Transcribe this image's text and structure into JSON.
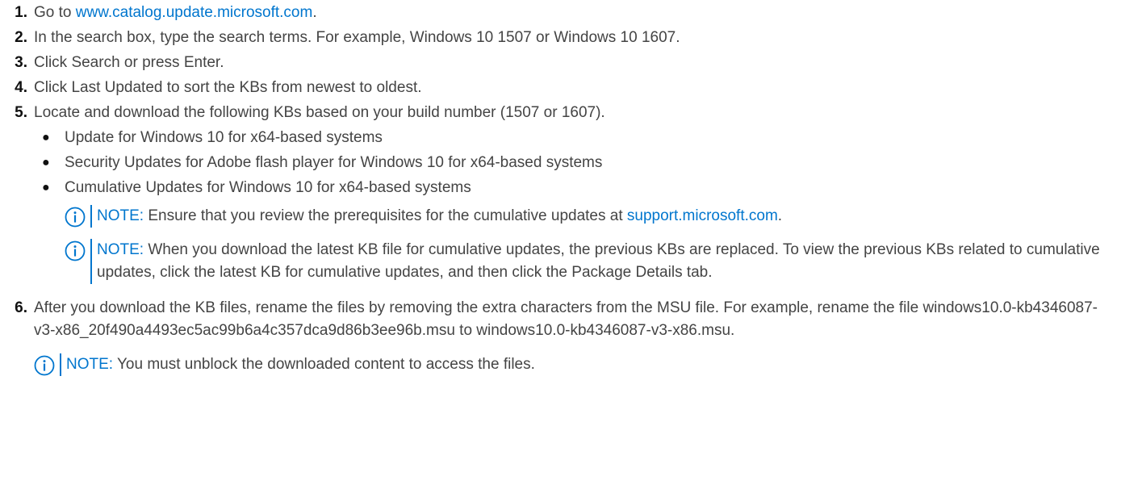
{
  "steps": [
    {
      "num": "1.",
      "prefix": "Go to ",
      "link": "www.catalog.update.microsoft.com",
      "suffix": "."
    },
    {
      "num": "2.",
      "text": "In the search box, type the search terms. For example, Windows 10 1507 or Windows 10 1607."
    },
    {
      "num": "3.",
      "text": "Click Search or press Enter."
    },
    {
      "num": "4.",
      "text": "Click Last Updated to sort the KBs from newest to oldest."
    },
    {
      "num": "5.",
      "text": "Locate and download the following KBs based on your build number (1507 or 1607)."
    },
    {
      "num": "6.",
      "text": "After you download the KB files, rename the files by removing the extra characters from the MSU file. For example, rename the file windows10.0-kb4346087-v3-x86_20f490a4493ec5ac99b6a4c357dca9d86b3ee96b.msu to windows10.0-kb4346087-v3-x86.msu."
    }
  ],
  "bullet_symbol": "●",
  "bullets": [
    "Update for Windows 10 for x64-based systems",
    "Security Updates for Adobe flash player for Windows 10 for x64-based systems",
    "Cumulative Updates for Windows 10 for x64-based systems"
  ],
  "note_label": "NOTE:",
  "notes": {
    "prerequisites": {
      "text": " Ensure that you review the prerequisites for the cumulative updates at ",
      "link": "support.microsoft.com",
      "suffix": "."
    },
    "replaced": {
      "text": " When you download the latest KB file for cumulative updates, the previous KBs are replaced. To view the previous KBs related to cumulative updates, click the latest KB for cumulative updates, and then click the Package Details tab."
    },
    "unblock": {
      "text": " You must unblock the downloaded content to access the files."
    }
  },
  "colors": {
    "accent": "#0076ce",
    "text": "#444444",
    "number": "#111111"
  },
  "note_icon": "info-circle-icon"
}
